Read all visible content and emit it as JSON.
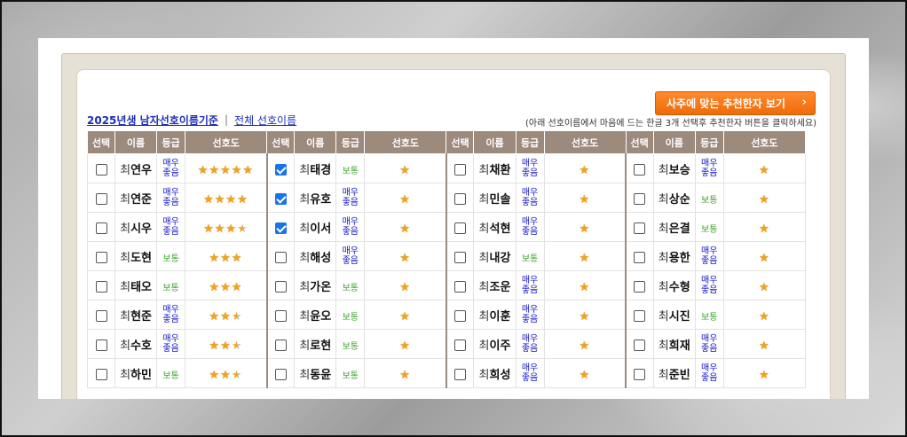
{
  "header": {
    "recommend_button": "사주에 맞는 추천한자 보기",
    "tab_active": "2025년생 남자선호이름기준",
    "tab_separator": "|",
    "tab_all": "전체 선호이름",
    "hint": "(아래 선호이름에서 마음에 드는 한글 3개 선택후 추천한자 버튼을 클릭하세요)"
  },
  "columns": [
    "선택",
    "이름",
    "등급",
    "선호도"
  ],
  "surname": "최",
  "grade_labels": {
    "good": "매우좋음",
    "normal": "보통"
  },
  "star_glyph": "★",
  "groups": [
    [
      {
        "given": "연우",
        "checked": false,
        "grade": "good",
        "stars": 5
      },
      {
        "given": "연준",
        "checked": false,
        "grade": "good",
        "stars": 4
      },
      {
        "given": "시우",
        "checked": false,
        "grade": "good",
        "stars": 3.5
      },
      {
        "given": "도현",
        "checked": false,
        "grade": "normal",
        "stars": 3
      },
      {
        "given": "태오",
        "checked": false,
        "grade": "normal",
        "stars": 3
      },
      {
        "given": "현준",
        "checked": false,
        "grade": "good",
        "stars": 2.5
      },
      {
        "given": "수호",
        "checked": false,
        "grade": "good",
        "stars": 2.5
      },
      {
        "given": "하민",
        "checked": false,
        "grade": "normal",
        "stars": 2.5
      }
    ],
    [
      {
        "given": "태경",
        "checked": true,
        "grade": "normal",
        "stars": 1
      },
      {
        "given": "유호",
        "checked": true,
        "grade": "good",
        "stars": 1
      },
      {
        "given": "이서",
        "checked": true,
        "grade": "good",
        "stars": 1
      },
      {
        "given": "해성",
        "checked": false,
        "grade": "good",
        "stars": 1
      },
      {
        "given": "가온",
        "checked": false,
        "grade": "normal",
        "stars": 1
      },
      {
        "given": "윤오",
        "checked": false,
        "grade": "normal",
        "stars": 1
      },
      {
        "given": "로현",
        "checked": false,
        "grade": "normal",
        "stars": 1
      },
      {
        "given": "동윤",
        "checked": false,
        "grade": "normal",
        "stars": 1
      }
    ],
    [
      {
        "given": "채환",
        "checked": false,
        "grade": "good",
        "stars": 1
      },
      {
        "given": "민솔",
        "checked": false,
        "grade": "good",
        "stars": 1
      },
      {
        "given": "석현",
        "checked": false,
        "grade": "good",
        "stars": 1
      },
      {
        "given": "내강",
        "checked": false,
        "grade": "normal",
        "stars": 1
      },
      {
        "given": "조운",
        "checked": false,
        "grade": "good",
        "stars": 1
      },
      {
        "given": "이훈",
        "checked": false,
        "grade": "good",
        "stars": 1
      },
      {
        "given": "이주",
        "checked": false,
        "grade": "good",
        "stars": 1
      },
      {
        "given": "희성",
        "checked": false,
        "grade": "good",
        "stars": 1
      }
    ],
    [
      {
        "given": "보승",
        "checked": false,
        "grade": "good",
        "stars": 1
      },
      {
        "given": "상순",
        "checked": false,
        "grade": "normal",
        "stars": 1
      },
      {
        "given": "은결",
        "checked": false,
        "grade": "normal",
        "stars": 1
      },
      {
        "given": "용한",
        "checked": false,
        "grade": "good",
        "stars": 1
      },
      {
        "given": "수형",
        "checked": false,
        "grade": "good",
        "stars": 1
      },
      {
        "given": "시진",
        "checked": false,
        "grade": "normal",
        "stars": 1
      },
      {
        "given": "희재",
        "checked": false,
        "grade": "good",
        "stars": 1
      },
      {
        "given": "준빈",
        "checked": false,
        "grade": "good",
        "stars": 1
      }
    ]
  ]
}
